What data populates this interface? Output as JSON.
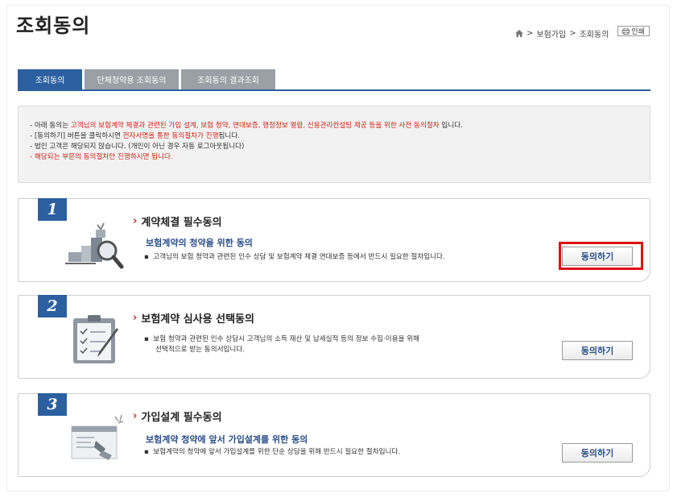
{
  "header": {
    "title": "조회동의",
    "breadcrumb": [
      "보험가입",
      "조회동의"
    ],
    "print_label": "인쇄"
  },
  "tabs": [
    {
      "label": "조회동의",
      "active": true
    },
    {
      "label": "단체청약용 조회동의",
      "active": false
    },
    {
      "label": "조회동의 결과조회",
      "active": false
    }
  ],
  "notice": {
    "line1_a": "- 아래 동의는 ",
    "line1_b": "고객님의 보험계약 체결과 관련된 가입 설계, 보험 청약, 연대보증, 행정정보 열람, 신용관리컨설팅 제공 등을 위한 사전 동의절차",
    "line1_c": " 입니다.",
    "line2_a": "- [동의하기] 버튼을 클릭하시면 ",
    "line2_b": "전자서명을 통한 동의절차가 진행",
    "line2_c": "됩니다.",
    "line3": "- 법인 고객은 해당되지 않습니다. (개인이 아닌 경우 자동 로그아웃됩니다)",
    "line4_a": "- ",
    "line4_b": "해당되는 부문의 동의절차만 진행하시면 됩니다."
  },
  "cards": [
    {
      "number": "1",
      "title": "계약체결 필수동의",
      "subtitle": "보험계약의 청약을 위한 동의",
      "desc1": "고객님의 보험 청약과 관련된 인수 상담 및 보험계약 체결 연대보증 등에서 반드시 필요한 절차입니다.",
      "desc2": "",
      "button": "동의하기",
      "highlighted": true
    },
    {
      "number": "2",
      "title": "보험계약 심사용 선택동의",
      "subtitle": "",
      "desc1": "보험 청약과 관련된 인수 상담시 고객님의 소득 재산 및 납세실적 등의 정보 수집·이용을 위해",
      "desc2": "선택적으로 받는 동의서입니다.",
      "button": "동의하기",
      "highlighted": false
    },
    {
      "number": "3",
      "title": "가입설계 필수동의",
      "subtitle": "보험계약 청약에 앞서 가입설계를 위한 동의",
      "desc1": "보험계약의 청약에 앞서 가입설계를 위한 단순 상담을 위해 반드시 필요한 절차입니다.",
      "desc2": "",
      "button": "동의하기",
      "highlighted": false
    }
  ],
  "colors": {
    "accent": "#2b5f9f",
    "red": "#d2231a",
    "highlight_box": "#e01010"
  }
}
